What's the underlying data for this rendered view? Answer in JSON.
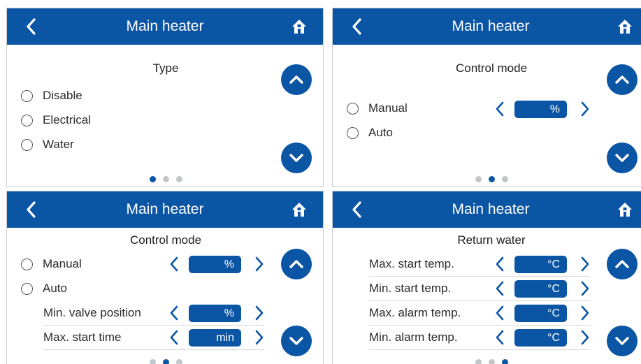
{
  "colors": {
    "brand_blue": "#0b55a5",
    "inactive_dot": "#c3c6c9"
  },
  "screens": [
    {
      "header": {
        "title": "Main heater",
        "back_icon": "chevron-left-icon",
        "home_icon": "home-icon"
      },
      "subtitle": "Type",
      "options": [
        "Disable",
        "Electrical",
        "Water"
      ],
      "pager": {
        "page": 1,
        "total": 3
      }
    },
    {
      "header": {
        "title": "Main heater",
        "back_icon": "chevron-left-icon",
        "home_icon": "home-icon"
      },
      "subtitle": "Control mode",
      "options": [
        "Manual",
        "Auto"
      ],
      "manual_unit": "%",
      "pager": {
        "page": 2,
        "total": 3
      }
    },
    {
      "header": {
        "title": "Main heater",
        "back_icon": "chevron-left-icon",
        "home_icon": "home-icon"
      },
      "subtitle": "Control mode",
      "options": [
        "Manual",
        "Auto"
      ],
      "manual_unit": "%",
      "settings": [
        {
          "label": "Min. valve position",
          "unit": "%"
        },
        {
          "label": "Max. start time",
          "unit": "min"
        }
      ],
      "pager": {
        "page": 2,
        "total": 3
      }
    },
    {
      "header": {
        "title": "Main heater",
        "back_icon": "chevron-left-icon",
        "home_icon": "home-icon"
      },
      "subtitle": "Return water",
      "settings": [
        {
          "label": "Max. start temp.",
          "unit": "°C"
        },
        {
          "label": "Min. start temp.",
          "unit": "°C"
        },
        {
          "label": "Max. alarm temp.",
          "unit": "°C"
        },
        {
          "label": "Min. alarm temp.",
          "unit": "°C"
        }
      ],
      "pager": {
        "page": 3,
        "total": 3
      }
    }
  ]
}
